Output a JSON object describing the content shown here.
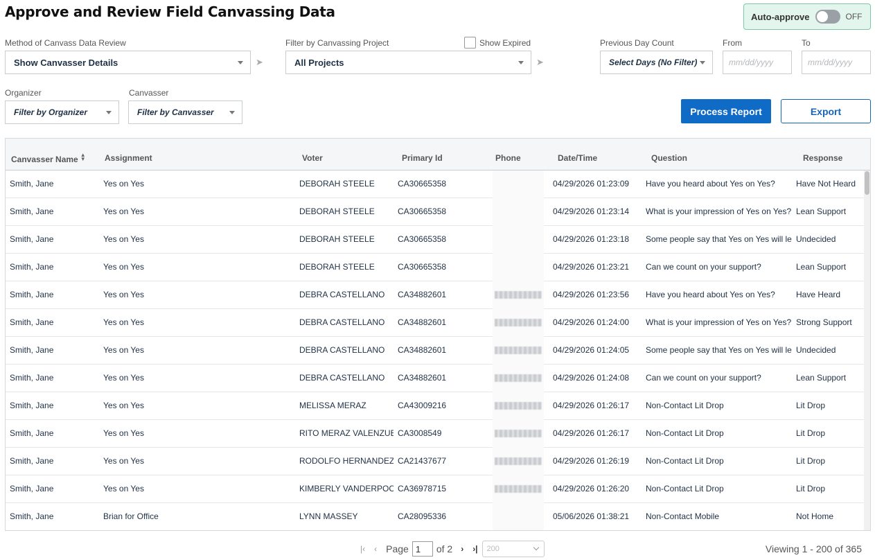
{
  "page_title": "Approve and Review Field Canvassing Data",
  "auto_approve": {
    "label": "Auto-approve",
    "state": "OFF"
  },
  "filters": {
    "method_label": "Method of Canvass Data Review",
    "method_value": "Show Canvasser Details",
    "project_label": "Filter by Canvassing Project",
    "project_value": "All Projects",
    "show_expired_label": "Show Expired",
    "previous_day_label": "Previous Day Count",
    "previous_day_value": "Select Days (No Filter)",
    "from_label": "From",
    "from_placeholder": "mm/dd/yyyy",
    "to_label": "To",
    "to_placeholder": "mm/dd/yyyy",
    "organizer_label": "Organizer",
    "organizer_value": "Filter by Organizer",
    "canvasser_label": "Canvasser",
    "canvasser_value": "Filter by Canvasser"
  },
  "buttons": {
    "process": "Process Report",
    "export": "Export"
  },
  "table": {
    "columns": [
      "Canvasser Name",
      "Assignment",
      "Voter",
      "Primary Id",
      "Phone",
      "Date/Time",
      "Question",
      "Response"
    ],
    "rows": [
      {
        "name": "Smith, Jane",
        "assignment": "Yes on Yes",
        "voter": "DEBORAH STEELE",
        "primary_id": "CA30665358",
        "phone": "",
        "datetime": "04/29/2026 01:23:09",
        "question": "Have you heard about Yes on Yes?",
        "response": "Have Not Heard"
      },
      {
        "name": "Smith, Jane",
        "assignment": "Yes on Yes",
        "voter": "DEBORAH STEELE",
        "primary_id": "CA30665358",
        "phone": "",
        "datetime": "04/29/2026 01:23:14",
        "question": "What is your impression of Yes on Yes?",
        "response": "Lean Support"
      },
      {
        "name": "Smith, Jane",
        "assignment": "Yes on Yes",
        "voter": "DEBORAH STEELE",
        "primary_id": "CA30665358",
        "phone": "",
        "datetime": "04/29/2026 01:23:18",
        "question": "Some people say that Yes on Yes will le",
        "response": "Undecided"
      },
      {
        "name": "Smith, Jane",
        "assignment": "Yes on Yes",
        "voter": "DEBORAH STEELE",
        "primary_id": "CA30665358",
        "phone": "",
        "datetime": "04/29/2026 01:23:21",
        "question": "Can we count on your support?",
        "response": "Lean Support"
      },
      {
        "name": "Smith, Jane",
        "assignment": "Yes on Yes",
        "voter": "DEBRA CASTELLANO",
        "primary_id": "CA34882601",
        "phone": "blurred",
        "datetime": "04/29/2026 01:23:56",
        "question": "Have you heard about Yes on Yes?",
        "response": "Have Heard"
      },
      {
        "name": "Smith, Jane",
        "assignment": "Yes on Yes",
        "voter": "DEBRA CASTELLANO",
        "primary_id": "CA34882601",
        "phone": "blurred",
        "datetime": "04/29/2026 01:24:00",
        "question": "What is your impression of Yes on Yes?",
        "response": "Strong Support"
      },
      {
        "name": "Smith, Jane",
        "assignment": "Yes on Yes",
        "voter": "DEBRA CASTELLANO",
        "primary_id": "CA34882601",
        "phone": "blurred",
        "datetime": "04/29/2026 01:24:05",
        "question": "Some people say that Yes on Yes will le",
        "response": "Undecided"
      },
      {
        "name": "Smith, Jane",
        "assignment": "Yes on Yes",
        "voter": "DEBRA CASTELLANO",
        "primary_id": "CA34882601",
        "phone": "blurred",
        "datetime": "04/29/2026 01:24:08",
        "question": "Can we count on your support?",
        "response": "Lean Support"
      },
      {
        "name": "Smith, Jane",
        "assignment": "Yes on Yes",
        "voter": "MELISSA MERAZ",
        "primary_id": "CA43009216",
        "phone": "blurred",
        "datetime": "04/29/2026 01:26:17",
        "question": "Non-Contact Lit Drop",
        "response": "Lit Drop"
      },
      {
        "name": "Smith, Jane",
        "assignment": "Yes on Yes",
        "voter": "RITO MERAZ VALENZUE",
        "primary_id": "CA3008549",
        "phone": "blurred",
        "datetime": "04/29/2026 01:26:17",
        "question": "Non-Contact Lit Drop",
        "response": "Lit Drop"
      },
      {
        "name": "Smith, Jane",
        "assignment": "Yes on Yes",
        "voter": "RODOLFO HERNANDEZ",
        "primary_id": "CA21437677",
        "phone": "blurred",
        "datetime": "04/29/2026 01:26:19",
        "question": "Non-Contact Lit Drop",
        "response": "Lit Drop"
      },
      {
        "name": "Smith, Jane",
        "assignment": "Yes on Yes",
        "voter": "KIMBERLY VANDERPOC",
        "primary_id": "CA36978715",
        "phone": "blurred",
        "datetime": "04/29/2026 01:26:20",
        "question": "Non-Contact Lit Drop",
        "response": "Lit Drop"
      },
      {
        "name": "Smith, Jane",
        "assignment": "Brian for Office",
        "voter": "LYNN MASSEY",
        "primary_id": "CA28095336",
        "phone": "",
        "datetime": "05/06/2026 01:38:21",
        "question": "Non-Contact Mobile",
        "response": "Not Home"
      }
    ]
  },
  "pager": {
    "page_label": "Page",
    "page_value": "1",
    "of_label": "of 2",
    "page_size": "200",
    "viewing": "Viewing 1 - 200 of 365"
  },
  "colors": {
    "primary": "#0f6bc6",
    "toggle_bg": "#e3f6ee"
  }
}
